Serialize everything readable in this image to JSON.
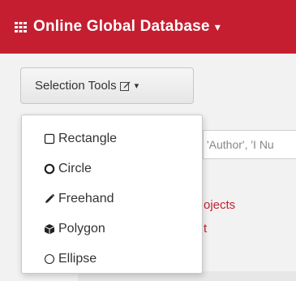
{
  "header": {
    "title": "Online Global Database",
    "caret": "▾"
  },
  "toolbar": {
    "selection_tools_label": "Selection Tools",
    "caret": "▾"
  },
  "search": {
    "value_snippet": "'Author', 'I Nu"
  },
  "background_links": {
    "link1": "ojects",
    "link2": "t"
  },
  "dropdown": {
    "items": [
      {
        "label": "Rectangle",
        "icon": "square-outline-icon"
      },
      {
        "label": "Circle",
        "icon": "circle-bold-icon"
      },
      {
        "label": "Freehand",
        "icon": "pencil-icon"
      },
      {
        "label": "Polygon",
        "icon": "cube-icon"
      },
      {
        "label": "Ellipse",
        "icon": "circle-outline-icon"
      }
    ]
  },
  "colors": {
    "brand_red": "#c51e30",
    "button_bg": "#ececec",
    "menu_bg": "#ffffff",
    "text": "#333333"
  }
}
